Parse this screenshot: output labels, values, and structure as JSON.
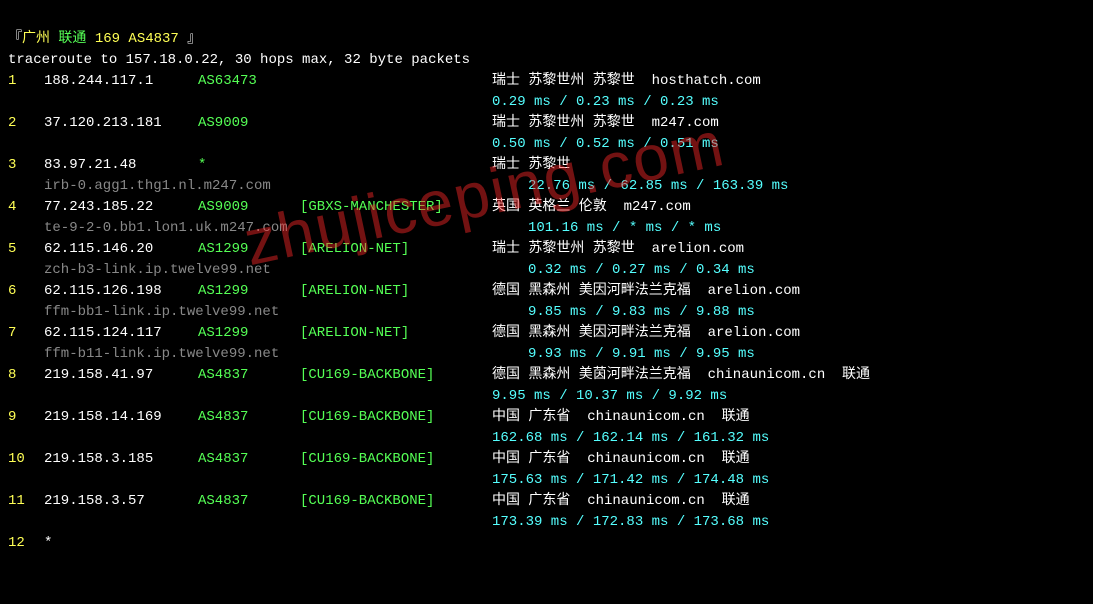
{
  "header": {
    "bracket_l": "『",
    "city": "广州",
    "isp": "联通",
    "asn": "169 AS4837",
    "bracket_r": "』"
  },
  "trace_line": "traceroute to 157.18.0.22, 30 hops max, 32 byte packets",
  "watermark": "zhujiceping.com",
  "hops": [
    {
      "n": "1",
      "ip": "188.244.117.1",
      "as": "AS63473",
      "tag": "",
      "loc": "瑞士 苏黎世州 苏黎世  hosthatch.com",
      "ms": "0.29 ms / 0.23 ms / 0.23 ms",
      "rdns": ""
    },
    {
      "n": "2",
      "ip": "37.120.213.181",
      "as": "AS9009",
      "tag": "",
      "loc": "瑞士 苏黎世州 苏黎世  m247.com",
      "ms": "0.50 ms / 0.52 ms / 0.51 ms",
      "rdns": ""
    },
    {
      "n": "3",
      "ip": "83.97.21.48",
      "as": "*",
      "tag": "",
      "loc": "瑞士 苏黎世",
      "ms": "22.76 ms / 62.85 ms / 163.39 ms",
      "rdns": "irb-0.agg1.thg1.nl.m247.com"
    },
    {
      "n": "4",
      "ip": "77.243.185.22",
      "as": "AS9009",
      "tag": "[GBXS-MANCHESTER]",
      "loc": "英国 英格兰 伦敦  m247.com",
      "ms": "101.16 ms / * ms / * ms",
      "rdns": "te-9-2-0.bb1.lon1.uk.m247.com"
    },
    {
      "n": "5",
      "ip": "62.115.146.20",
      "as": "AS1299",
      "tag": "[ARELION-NET]",
      "loc": "瑞士 苏黎世州 苏黎世  arelion.com",
      "ms": "0.32 ms / 0.27 ms / 0.34 ms",
      "rdns": "zch-b3-link.ip.twelve99.net"
    },
    {
      "n": "6",
      "ip": "62.115.126.198",
      "as": "AS1299",
      "tag": "[ARELION-NET]",
      "loc": "德国 黑森州 美因河畔法兰克福  arelion.com",
      "ms": "9.85 ms / 9.83 ms / 9.88 ms",
      "rdns": "ffm-bb1-link.ip.twelve99.net"
    },
    {
      "n": "7",
      "ip": "62.115.124.117",
      "as": "AS1299",
      "tag": "[ARELION-NET]",
      "loc": "德国 黑森州 美因河畔法兰克福  arelion.com",
      "ms": "9.93 ms / 9.91 ms / 9.95 ms",
      "rdns": "ffm-b11-link.ip.twelve99.net"
    },
    {
      "n": "8",
      "ip": "219.158.41.97",
      "as": "AS4837",
      "tag": "[CU169-BACKBONE]",
      "loc": "德国 黑森州 美茵河畔法兰克福  chinaunicom.cn  联通",
      "ms": "9.95 ms / 10.37 ms / 9.92 ms",
      "rdns": ""
    },
    {
      "n": "9",
      "ip": "219.158.14.169",
      "as": "AS4837",
      "tag": "[CU169-BACKBONE]",
      "loc": "中国 广东省  chinaunicom.cn  联通",
      "ms": "162.68 ms / 162.14 ms / 161.32 ms",
      "rdns": ""
    },
    {
      "n": "10",
      "ip": "219.158.3.185",
      "as": "AS4837",
      "tag": "[CU169-BACKBONE]",
      "loc": "中国 广东省  chinaunicom.cn  联通",
      "ms": "175.63 ms / 171.42 ms / 174.48 ms",
      "rdns": ""
    },
    {
      "n": "11",
      "ip": "219.158.3.57",
      "as": "AS4837",
      "tag": "[CU169-BACKBONE]",
      "loc": "中国 广东省  chinaunicom.cn  联通",
      "ms": "173.39 ms / 172.83 ms / 173.68 ms",
      "rdns": ""
    },
    {
      "n": "12",
      "ip": "*",
      "as": "",
      "tag": "",
      "loc": "",
      "ms": "",
      "rdns": ""
    }
  ]
}
